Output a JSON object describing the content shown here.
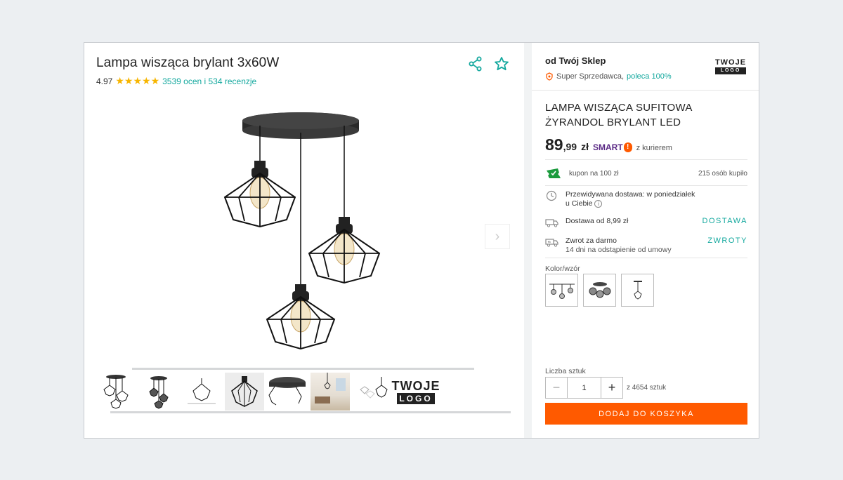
{
  "product": {
    "title": "Lampa wisząca brylant 3x60W",
    "rating_value": "4.97",
    "rating_stars": "★★★★★",
    "rating_link": "3539 ocen i 534 recenzje"
  },
  "icons": {
    "share": "share-icon",
    "favorite": "star-outline-icon",
    "next": "chevron-right-icon"
  },
  "gallery": {
    "next_arrow": "›",
    "thumbnail_logo_top": "TWOJE",
    "thumbnail_logo_bottom": "LOGO"
  },
  "seller": {
    "name": "od Twój Sklep",
    "badge": "Super Sprzedawca,",
    "recommend": "poleca 100%",
    "logo_top": "TWOJE",
    "logo_bottom": "LOGO"
  },
  "offer": {
    "name": "LAMPA WISZĄCA SUFITOWA ŻYRANDOL BRYLANT LED",
    "price_main": "89",
    "price_cents": ",99",
    "currency": "zł",
    "smart_label": "SMART",
    "smart_badge": "!",
    "courier": "z kurierem",
    "coupon": "kupon na 100 zł",
    "bought": "215 osób kupiło"
  },
  "delivery": {
    "estimate_line1": "Przewidywana dostawa: w poniedziałek",
    "estimate_line2": "u Ciebie",
    "help": "i",
    "cost": "Dostawa od 8,99 zł",
    "cost_link": "DOSTAWA",
    "return_title": "Zwrot za darmo",
    "return_sub": "14 dni na odstąpienie od umowy",
    "return_link": "ZWROTY"
  },
  "variants": {
    "label": "Kolor/wzór"
  },
  "quantity": {
    "label": "Liczba sztuk",
    "minus": "−",
    "value": "1",
    "plus": "+",
    "available": "z 4654 sztuk"
  },
  "cart": {
    "button": "DODAJ DO KOSZYKA"
  },
  "colors": {
    "accent_teal": "#13a89e",
    "cta_orange": "#ff5a00",
    "star_yellow": "#f7b500",
    "smart_purple": "#5b2a86"
  }
}
